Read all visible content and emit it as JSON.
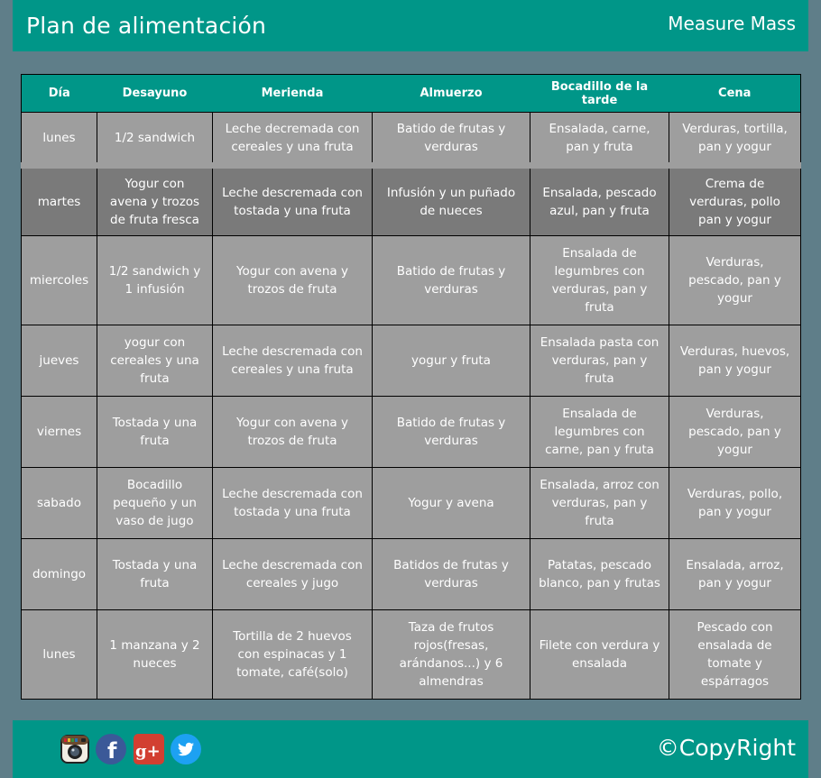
{
  "header": {
    "title": "Plan de alimentación",
    "brand": "Measure Mass"
  },
  "table": {
    "headers": [
      "Día",
      "Desayuno",
      "Merienda",
      "Almuerzo",
      "Bocadillo de la tarde",
      "Cena"
    ],
    "rows": [
      [
        "lunes",
        "1/2 sandwich",
        "Leche decremada con cereales y una fruta",
        "Batido de frutas y verduras",
        "Ensalada, carne, pan y fruta",
        "Verduras, tortilla, pan y yogur"
      ],
      [
        "martes",
        "Yogur con avena y trozos de fruta fresca",
        "Leche descremada con tostada y una fruta",
        "Infusión y un puñado de nueces",
        "Ensalada, pescado azul, pan y fruta",
        "Crema de verduras, pollo pan y yogur"
      ],
      [
        "miercoles",
        "1/2 sandwich y 1 infusión",
        "Yogur con avena y trozos de fruta",
        "Batido de frutas y verduras",
        "Ensalada de legumbres con verduras, pan y fruta",
        "Verduras, pescado, pan y yogur"
      ],
      [
        "jueves",
        "yogur con cereales y una fruta",
        "Leche descremada con cereales y una fruta",
        "yogur y fruta",
        "Ensalada pasta con verduras, pan y fruta",
        "Verduras, huevos, pan y yogur"
      ],
      [
        "viernes",
        "Tostada y una fruta",
        "Yogur con avena y trozos de fruta",
        "Batido de frutas y verduras",
        "Ensalada de legumbres con carne, pan y fruta",
        "Verduras, pescado, pan y yogur"
      ],
      [
        "sabado",
        "Bocadillo pequeño y un vaso de jugo",
        "Leche descremada con tostada y una fruta",
        "Yogur y avena",
        "Ensalada, arroz con verduras, pan y fruta",
        "Verduras, pollo, pan y yogur"
      ],
      [
        "domingo",
        "Tostada y una fruta",
        "Leche descremada con cereales y jugo",
        "Batidos de frutas y verduras",
        "Patatas, pescado blanco, pan y frutas",
        "Ensalada, arroz, pan y yogur"
      ],
      [
        "lunes",
        "1 manzana y 2 nueces",
        "Tortilla de 2 huevos con espinacas y 1 tomate, café(solo)",
        "Taza de frutos rojos(fresas, arándanos...) y 6 almendras",
        "Filete con verdura y ensalada",
        "Pescado con ensalada de tomate y espárragos"
      ]
    ]
  },
  "footer": {
    "copyright": "©CopyRight",
    "social": [
      "instagram-icon",
      "facebook-icon",
      "google-plus-icon",
      "twitter-icon"
    ],
    "google_plus_glyph": "g+",
    "facebook_glyph": "f"
  },
  "colors": {
    "teal": "#009688",
    "background": "#5f7e89",
    "cell": "#9e9e9e",
    "highlight_row": "#7a7a7a"
  }
}
